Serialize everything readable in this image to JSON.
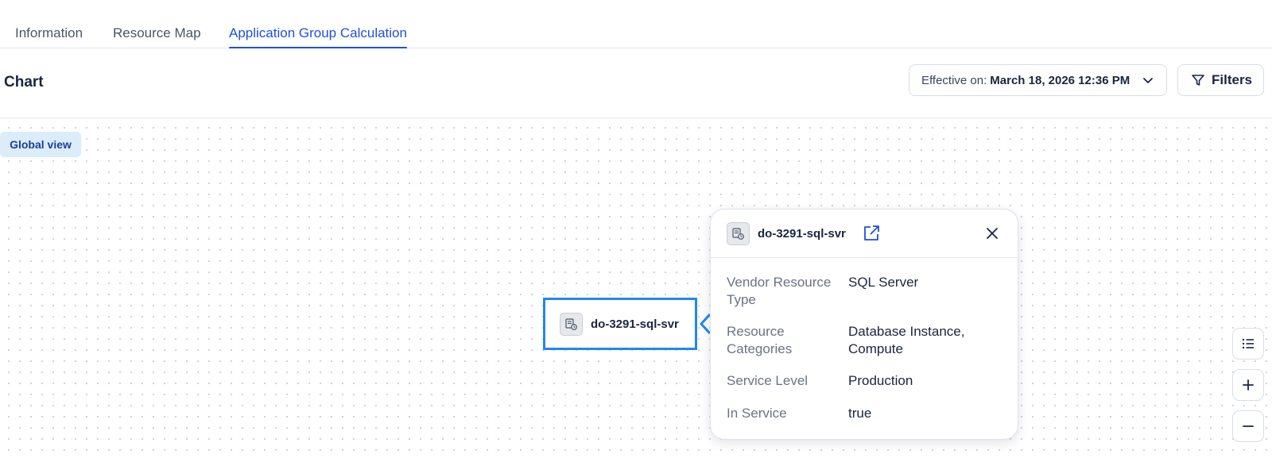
{
  "tabs": [
    {
      "label": "Information",
      "active": false
    },
    {
      "label": "Resource Map",
      "active": false
    },
    {
      "label": "Application Group Calculation",
      "active": true
    }
  ],
  "header": {
    "title": "Chart",
    "effective_label": "Effective on:",
    "effective_date": "March 18, 2026 12:36 PM",
    "filters_label": "Filters"
  },
  "canvas": {
    "global_view_label": "Global view",
    "node": {
      "label": "do-3291-sql-svr",
      "icon": "database-server-icon"
    }
  },
  "popover": {
    "title": "do-3291-sql-svr",
    "properties": [
      {
        "label": "Vendor Resource Type",
        "value": "SQL Server"
      },
      {
        "label": "Resource Categories",
        "value": "Database Instance, Compute"
      },
      {
        "label": "Service Level",
        "value": "Production"
      },
      {
        "label": "In Service",
        "value": "true"
      }
    ]
  },
  "toolbar": {
    "items": [
      "list-icon",
      "zoom-in-icon",
      "zoom-out-icon"
    ]
  },
  "colors": {
    "accent": "#1f4fe0",
    "node_border": "#1e88f2",
    "badge_bg": "#dbecfb"
  }
}
